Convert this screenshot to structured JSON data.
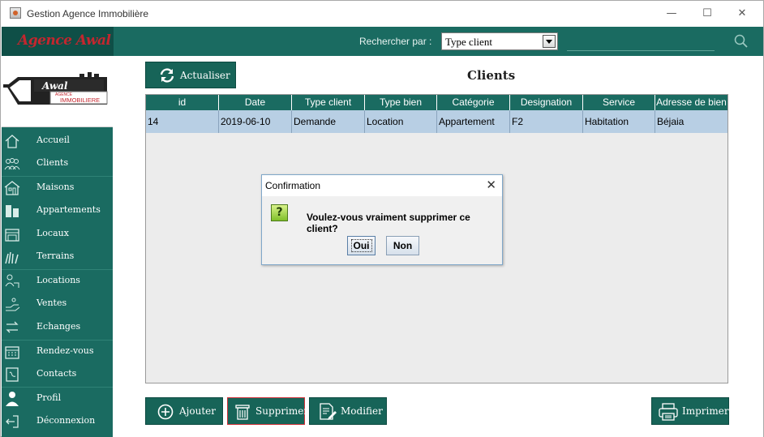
{
  "window": {
    "title": "Gestion Agence Immobilière",
    "controls": [
      "—",
      "☐",
      "✕"
    ]
  },
  "topbar": {
    "brand": "Agence Awal",
    "search_label": "Rechercher par :",
    "search_by_value": "Type client",
    "search_query": ""
  },
  "logo": {
    "word": "Awal",
    "subtitle": "IMMOBILIERE",
    "small": "AGENCE"
  },
  "sidebar": {
    "items": [
      {
        "label": "Accueil",
        "icon": "home-icon"
      },
      {
        "label": "Clients",
        "icon": "clients-icon"
      },
      {
        "label": "Maisons",
        "icon": "house-icon"
      },
      {
        "label": "Appartements",
        "icon": "building-icon"
      },
      {
        "label": "Locaux",
        "icon": "store-icon"
      },
      {
        "label": "Terrains",
        "icon": "land-icon"
      },
      {
        "label": "Locations",
        "icon": "rental-icon"
      },
      {
        "label": "Ventes",
        "icon": "sale-icon"
      },
      {
        "label": "Echanges",
        "icon": "exchange-icon"
      },
      {
        "label": "Rendez-vous",
        "icon": "calendar-icon"
      },
      {
        "label": "Contacts",
        "icon": "contacts-icon"
      },
      {
        "label": "Profil",
        "icon": "user-icon"
      },
      {
        "label": "Déconnexion",
        "icon": "logout-icon"
      }
    ]
  },
  "toolbar": {
    "refresh_label": "Actualiser",
    "add_label": "Ajouter",
    "delete_label": "Supprimer",
    "edit_label": "Modifier",
    "print_label": "Imprimer"
  },
  "main": {
    "title": "Clients"
  },
  "table": {
    "columns": [
      "id",
      "Date",
      "Type client",
      "Type bien",
      "Catégorie",
      "Designation",
      "Service",
      "Adresse de bien"
    ],
    "rows": [
      [
        "14",
        "2019-06-10",
        "Demande",
        "Location",
        "Appartement",
        "F2",
        "Habitation",
        "Béjaia"
      ]
    ]
  },
  "dialog": {
    "title": "Confirmation",
    "message": "Voulez-vous vraiment supprimer ce client?",
    "icon": "question-icon",
    "yes_label": "Oui",
    "no_label": "Non",
    "close_label": "✕"
  },
  "colors": {
    "teal": "#1a6b61",
    "teal_dark": "#0f4f47",
    "brand_red": "#c4262e",
    "row_selected": "#b8cfe4"
  }
}
